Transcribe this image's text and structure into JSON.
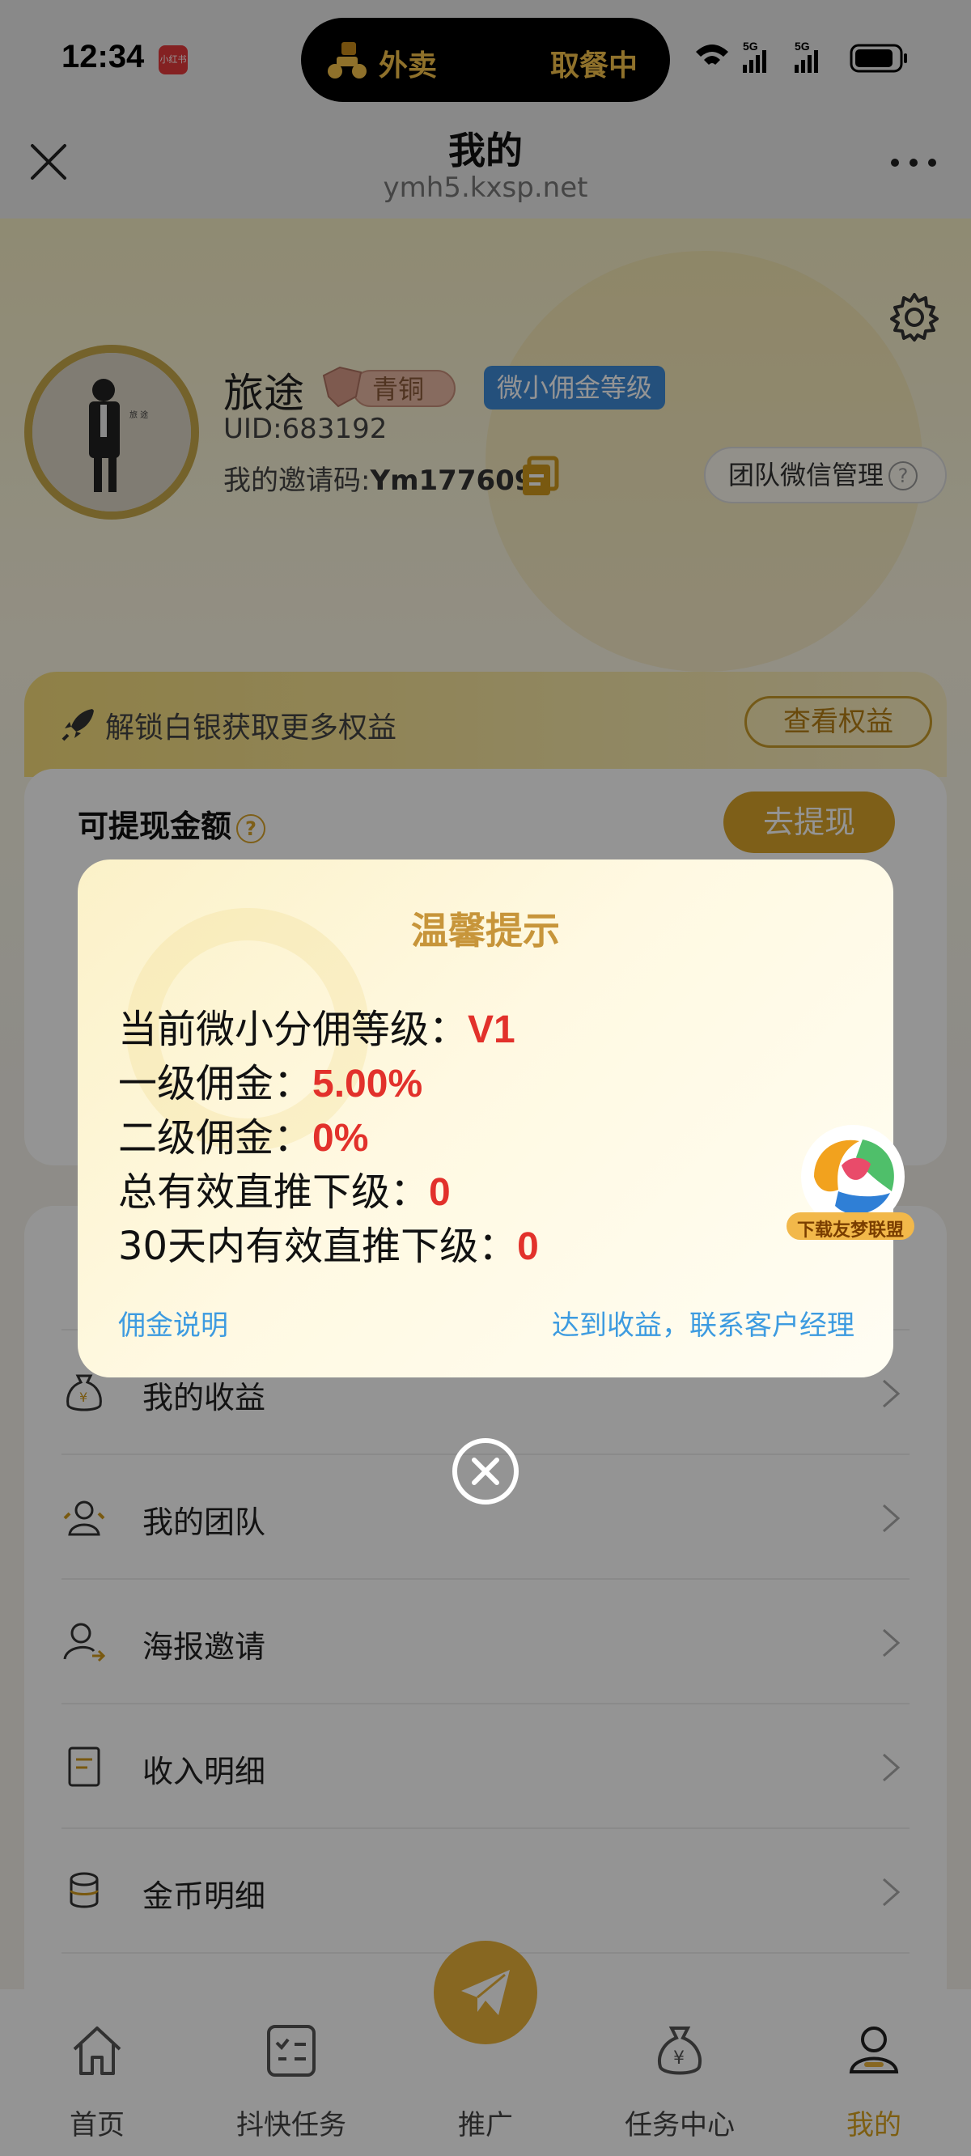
{
  "status": {
    "time": "12:34",
    "app_badge": "小红书",
    "island_left": "外卖",
    "island_right": "取餐中"
  },
  "nav": {
    "title": "我的",
    "url": "ymh5.kxsp.net"
  },
  "profile": {
    "name": "旅途",
    "tier": "青铜",
    "level_badge": "微小佣金等级",
    "uid": "UID:683192",
    "invite_prefix": "我的邀请码:",
    "invite_code": "Ym177609",
    "team_wechat": "团队微信管理"
  },
  "unlock": {
    "text": "解锁白银获取更多权益",
    "button": "查看权益"
  },
  "withdraw": {
    "label": "可提现金额",
    "button": "去提现"
  },
  "menu": [
    {
      "label": "我的收益",
      "icon": "money-bag-icon"
    },
    {
      "label": "我的团队",
      "icon": "team-icon"
    },
    {
      "label": "海报邀请",
      "icon": "invite-person-icon"
    },
    {
      "label": "收入明细",
      "icon": "document-icon"
    },
    {
      "label": "金币明细",
      "icon": "coins-icon"
    }
  ],
  "tabs": [
    {
      "label": "首页",
      "icon": "home-icon"
    },
    {
      "label": "抖快任务",
      "icon": "task-list-icon"
    },
    {
      "label": "推广",
      "icon": "paper-plane-icon"
    },
    {
      "label": "任务中心",
      "icon": "money-bag-icon"
    },
    {
      "label": "我的",
      "icon": "user-icon"
    }
  ],
  "modal": {
    "title": "温馨提示",
    "lines": [
      {
        "label": "当前微小分佣等级：",
        "value": "V1"
      },
      {
        "label": "一级佣金：",
        "value": "5.00%"
      },
      {
        "label": "二级佣金：",
        "value": "0%"
      },
      {
        "label": "总有效直推下级：",
        "value": "0"
      },
      {
        "label": "30天内有效直推下级：",
        "value": "0"
      }
    ],
    "left_link": "佣金说明",
    "right_link": "达到收益，联系客户经理"
  },
  "float_ad": {
    "label": "下载友梦联盟"
  },
  "colors": {
    "accent": "#d8a21e",
    "value_red": "#e2312b",
    "link_blue": "#3d9be0",
    "badge_blue": "#3f8bd6"
  }
}
